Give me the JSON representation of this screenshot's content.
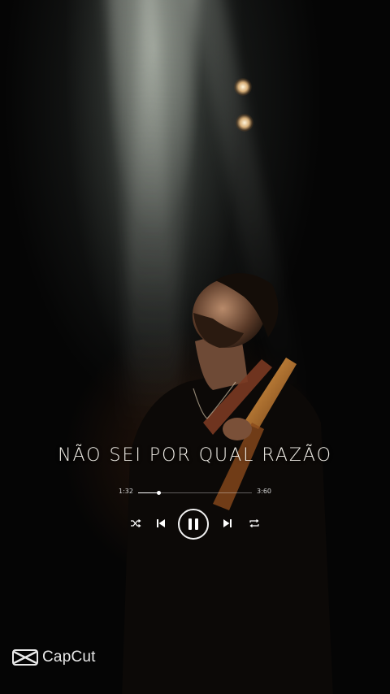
{
  "lyric": {
    "text": "NÃO SEI POR QUAL RAZÃO"
  },
  "player": {
    "current_time": "1:32",
    "total_time": "3:60",
    "progress": 0.18,
    "state": "playing"
  },
  "controls": {
    "shuffle_icon": "shuffle-icon",
    "previous_icon": "skip-previous-icon",
    "pause_icon": "pause-icon",
    "next_icon": "skip-next-icon",
    "repeat_icon": "repeat-icon"
  },
  "watermark": {
    "text": "CapCut",
    "icon": "capcut-logo-icon"
  },
  "colors": {
    "lyric": "#f4f1ea",
    "controls": "#ffffff",
    "background": "#050505"
  }
}
